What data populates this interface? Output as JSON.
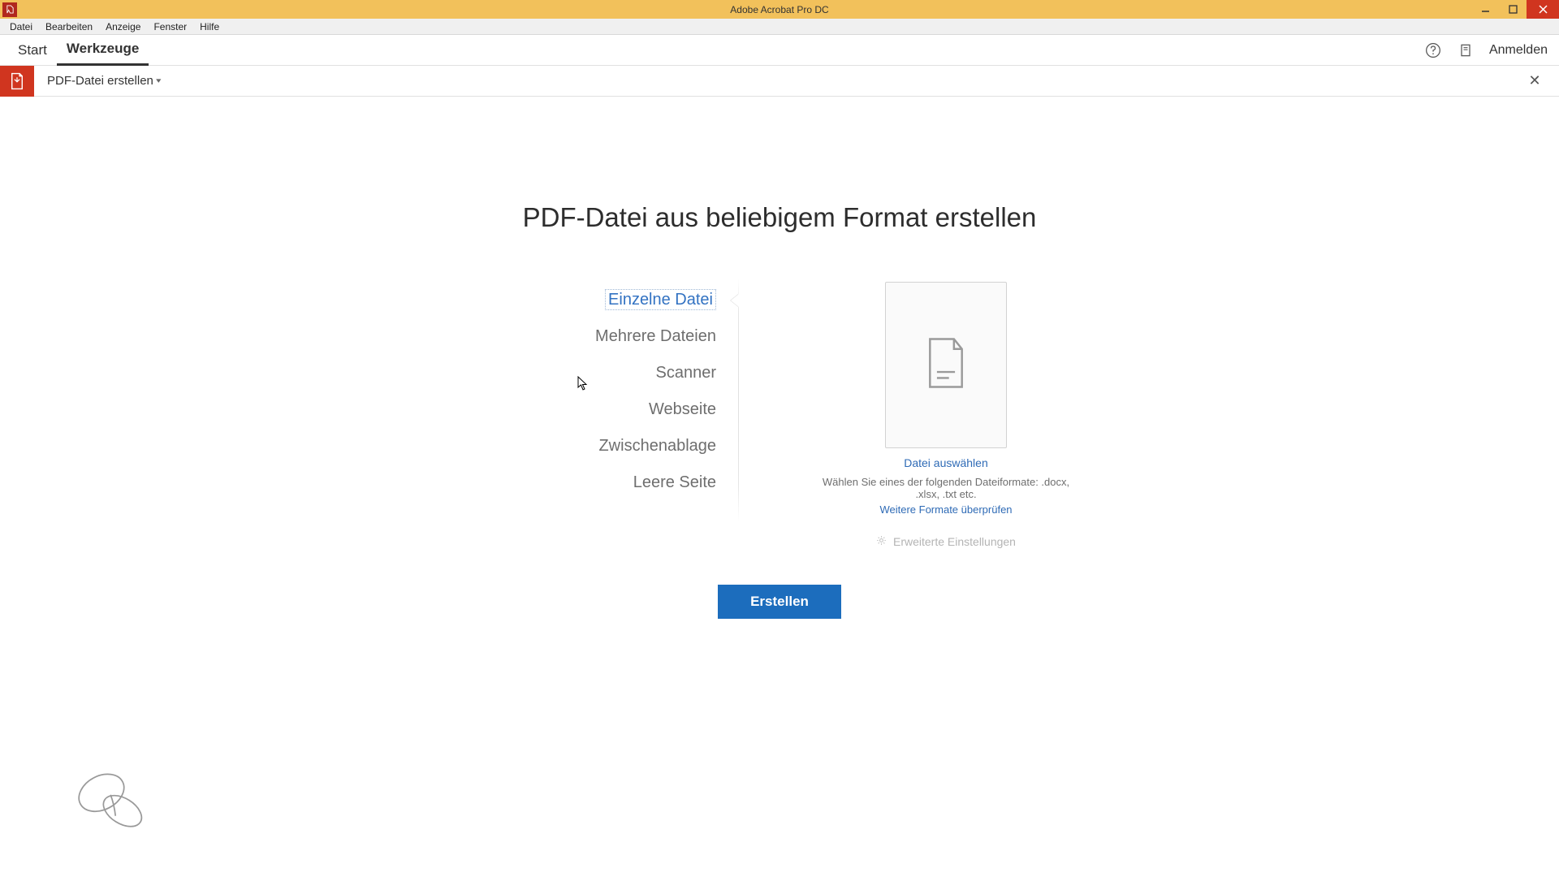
{
  "title": "Adobe Acrobat Pro DC",
  "menu": {
    "file": "Datei",
    "edit": "Bearbeiten",
    "view": "Anzeige",
    "window": "Fenster",
    "help": "Hilfe"
  },
  "tabs": {
    "start": "Start",
    "tools": "Werkzeuge",
    "signin": "Anmelden"
  },
  "toolbar": {
    "title": "PDF-Datei erstellen"
  },
  "heading": "PDF-Datei aus beliebigem Format erstellen",
  "options": {
    "single": "Einzelne Datei",
    "multiple": "Mehrere Dateien",
    "scanner": "Scanner",
    "website": "Webseite",
    "clipboard": "Zwischenablage",
    "blank": "Leere Seite"
  },
  "panel": {
    "select_file": "Datei auswählen",
    "hint": "Wählen Sie eines der folgenden Dateiformate: .docx, .xlsx, .txt etc.",
    "more_formats": "Weitere Formate überprüfen",
    "advanced": "Erweiterte Einstellungen"
  },
  "create_btn": "Erstellen"
}
